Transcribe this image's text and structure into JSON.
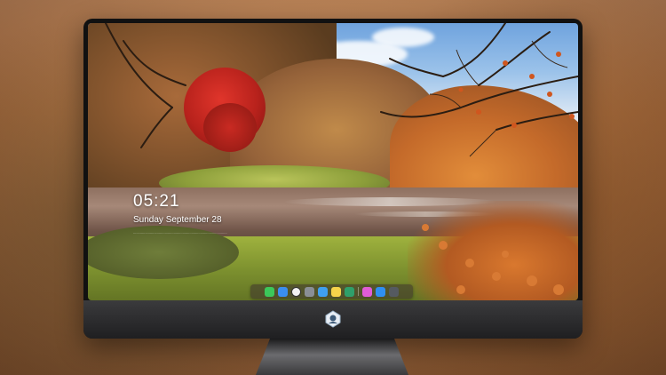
{
  "lock_screen": {
    "time": "05:21",
    "date": "Sunday September  28",
    "note": "..............................................................................................."
  },
  "dock": {
    "apps": [
      {
        "icon": "messages-icon",
        "color": "#3cc85a"
      },
      {
        "icon": "mail-icon",
        "color": "#3a8ef0"
      },
      {
        "icon": "clock-icon",
        "color": "#f2f2f2"
      },
      {
        "icon": "calculator-icon",
        "color": "#8a8f96"
      },
      {
        "icon": "video-icon",
        "color": "#3fa0f0"
      },
      {
        "icon": "notes-icon",
        "color": "#f5d34a"
      },
      {
        "icon": "photos-icon",
        "color": "#2f9f6a"
      },
      {
        "icon": "separator",
        "color": ""
      },
      {
        "icon": "music-icon",
        "color": "#e05cd6"
      },
      {
        "icon": "app-store-icon",
        "color": "#2f8ff2"
      },
      {
        "icon": "camera-icon",
        "color": "#555a60"
      }
    ]
  },
  "colors": {
    "bezel": "#111111",
    "chin": "#2f2f31",
    "background": "#b87a48"
  }
}
